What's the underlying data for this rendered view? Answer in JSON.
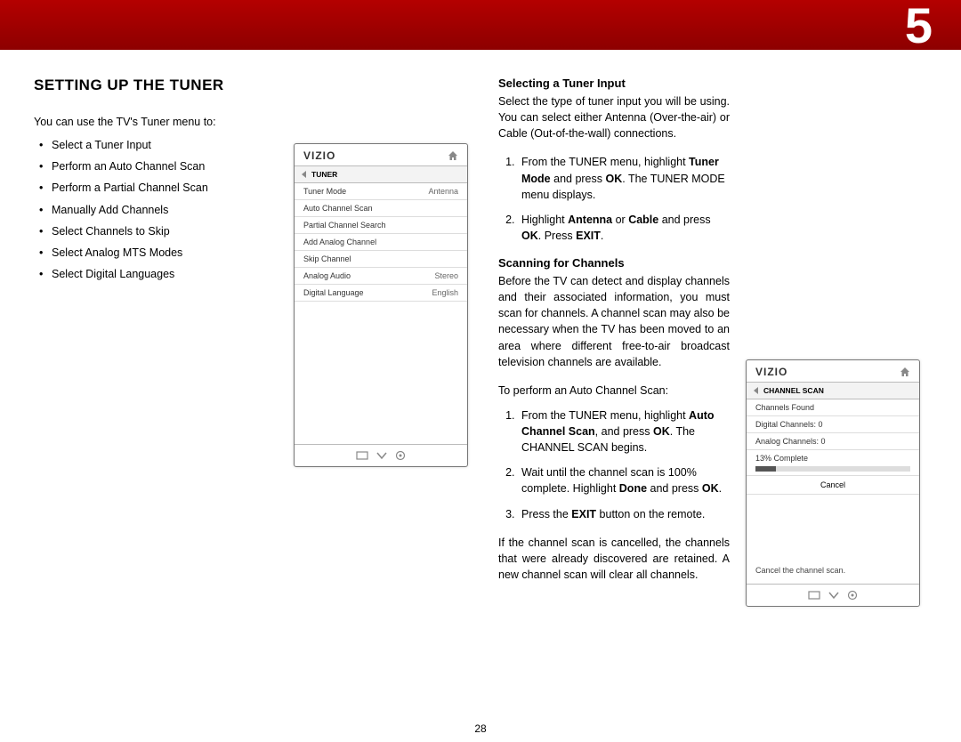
{
  "chapter": "5",
  "page_number": "28",
  "h1": "SETTING UP THE TUNER",
  "intro": "You can use the TV's Tuner menu to:",
  "bullets": [
    "Select a Tuner Input",
    "Perform an Auto Channel Scan",
    "Perform a Partial Channel Scan",
    "Manually Add Channels",
    "Select Channels to Skip",
    "Select Analog MTS Modes",
    "Select Digital Languages"
  ],
  "tuner_menu": {
    "logo": "VIZIO",
    "crumb": "TUNER",
    "rows": [
      {
        "label": "Tuner Mode",
        "value": "Antenna"
      },
      {
        "label": "Auto Channel Scan",
        "value": ""
      },
      {
        "label": "Partial Channel Search",
        "value": ""
      },
      {
        "label": "Add Analog Channel",
        "value": ""
      },
      {
        "label": "Skip Channel",
        "value": ""
      },
      {
        "label": "Analog Audio",
        "value": "Stereo"
      },
      {
        "label": "Digital Language",
        "value": "English"
      }
    ]
  },
  "sec1_title": "Selecting a Tuner Input",
  "sec1_p": "Select the type of tuner input you will be using. You can select either Antenna (Over-the-air) or Cable (Out-of-the-wall) connections.",
  "sec1_step1a": "From the TUNER menu, highlight ",
  "sec1_step1b": "Tuner Mode",
  "sec1_step1c": " and press ",
  "sec1_step1d": "OK",
  "sec1_step1e": ". The TUNER MODE menu displays.",
  "sec1_step2a": "Highlight ",
  "sec1_step2b": "Antenna",
  "sec1_step2c": " or ",
  "sec1_step2d": "Cable",
  "sec1_step2e": " and press ",
  "sec1_step2f": "OK",
  "sec1_step2g": ". Press ",
  "sec1_step2h": "EXIT",
  "sec1_step2i": ".",
  "sec2_title": "Scanning for Channels",
  "sec2_p1": "Before the TV can detect and display channels and their associated information, you must scan for channels. A channel scan may also be necessary when the TV has been moved to an area where different free-to-air broadcast television channels are available.",
  "sec2_p2": "To perform an Auto Channel Scan:",
  "sec2_step1a": "From the TUNER menu, highlight ",
  "sec2_step1b": "Auto Channel Scan",
  "sec2_step1c": ", and press ",
  "sec2_step1d": "OK",
  "sec2_step1e": ". The CHANNEL SCAN begins.",
  "sec2_step2a": "Wait until the channel scan is 100% complete. Highlight ",
  "sec2_step2b": "Done",
  "sec2_step2c": " and press ",
  "sec2_step2d": "OK",
  "sec2_step2e": ".",
  "sec2_step3a": "Press the ",
  "sec2_step3b": "EXIT",
  "sec2_step3c": " button on the remote.",
  "sec2_p3": "If the channel scan is cancelled, the channels that were already discovered are retained. A new channel scan will clear all channels.",
  "scan_menu": {
    "logo": "VIZIO",
    "crumb": "CHANNEL SCAN",
    "rows": [
      "Channels Found",
      "Digital Channels: 0",
      "Analog Channels: 0",
      "13% Complete"
    ],
    "cancel": "Cancel",
    "hint": "Cancel the channel scan."
  }
}
